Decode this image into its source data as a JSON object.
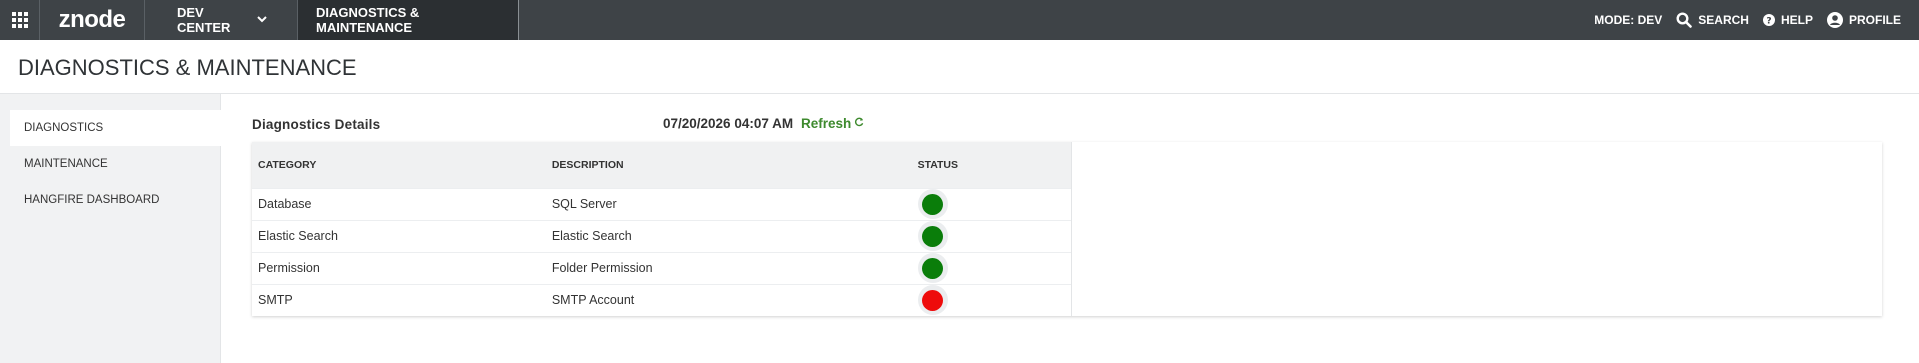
{
  "topbar": {
    "logo": "znode",
    "dev_center": "DEV CENTER",
    "active_menu": "DIAGNOSTICS & MAINTENANCE",
    "mode": "MODE: DEV",
    "search": "SEARCH",
    "help": "HELP",
    "profile": "PROFILE"
  },
  "page": {
    "title": "DIAGNOSTICS & MAINTENANCE"
  },
  "sidebar": {
    "items": [
      {
        "label": "DIAGNOSTICS",
        "active": true
      },
      {
        "label": "MAINTENANCE",
        "active": false
      },
      {
        "label": "HANGFIRE DASHBOARD",
        "active": false
      }
    ]
  },
  "diagnostics": {
    "title": "Diagnostics Details",
    "timestamp": "07/20/2026 04:07 AM",
    "refresh_label": "Refresh",
    "columns": [
      "CATEGORY",
      "DESCRIPTION",
      "STATUS"
    ],
    "rows": [
      {
        "category": "Database",
        "description": "SQL Server",
        "status": "ok",
        "color": "#0a7d0a"
      },
      {
        "category": "Elastic Search",
        "description": "Elastic Search",
        "status": "ok",
        "color": "#0a7d0a"
      },
      {
        "category": "Permission",
        "description": "Folder Permission",
        "status": "ok",
        "color": "#0a7d0a"
      },
      {
        "category": "SMTP",
        "description": "SMTP Account",
        "status": "error",
        "color": "#ee0b0b"
      }
    ]
  },
  "colors": {
    "topbar": "#3e4347",
    "active_menu": "#2b2f32",
    "refresh": "#3e8a2e"
  }
}
